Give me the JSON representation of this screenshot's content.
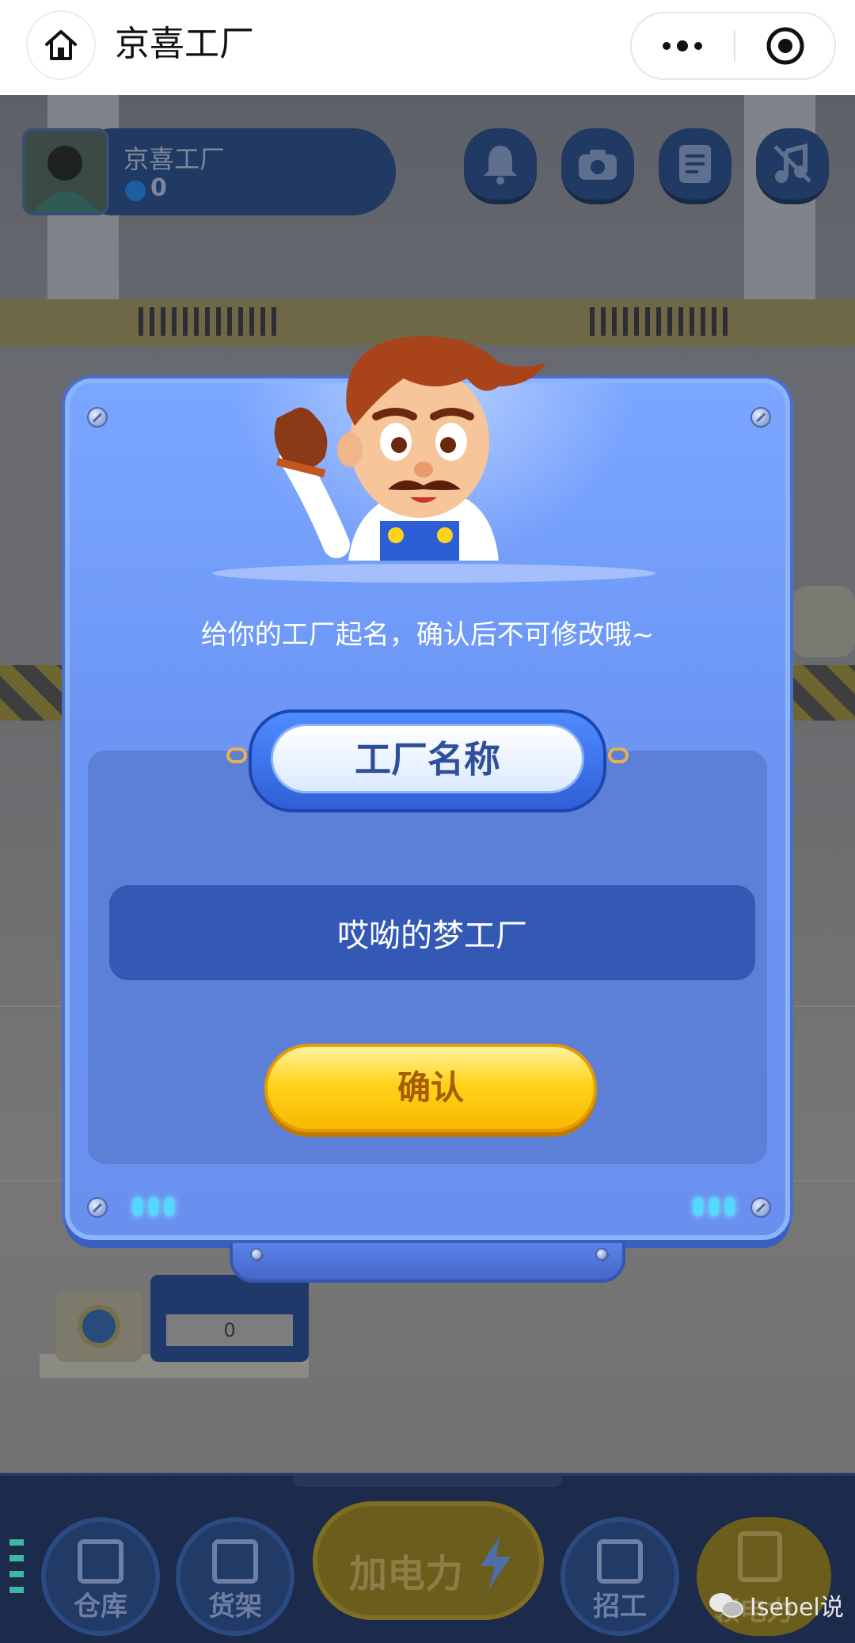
{
  "wechat_bar": {
    "title": "京喜工厂",
    "icons": [
      "home-icon",
      "more-icon",
      "target-icon"
    ]
  },
  "game": {
    "profile": {
      "name": "京喜工厂",
      "coins": "0"
    },
    "top_buttons": [
      "bell-icon",
      "camera-icon",
      "notes-icon",
      "music-off-icon"
    ],
    "machine_counter": "0",
    "bottom_nav": [
      {
        "label": "仓库",
        "icon": "warehouse-icon"
      },
      {
        "label": "货架",
        "icon": "shelf-icon"
      },
      {
        "label": "加电力",
        "icon": "lightning-icon"
      },
      {
        "label": "招工",
        "icon": "recruit-icon"
      },
      {
        "label": "领电力",
        "icon": "checklist-icon"
      }
    ]
  },
  "dialog": {
    "subtitle": "给你的工厂起名，确认后不可修改哦~",
    "plate_title": "工厂名称",
    "factory_name_value": "哎呦的梦工厂",
    "confirm_label": "确认"
  },
  "watermark": {
    "text": "Isebel说"
  },
  "colors": {
    "dialog_blue": "#6b94f3",
    "input_blue": "#3459b5",
    "confirm_yellow": "#ffd31b",
    "confirm_text": "#a65d00",
    "plate_text": "#2e4f9a"
  }
}
